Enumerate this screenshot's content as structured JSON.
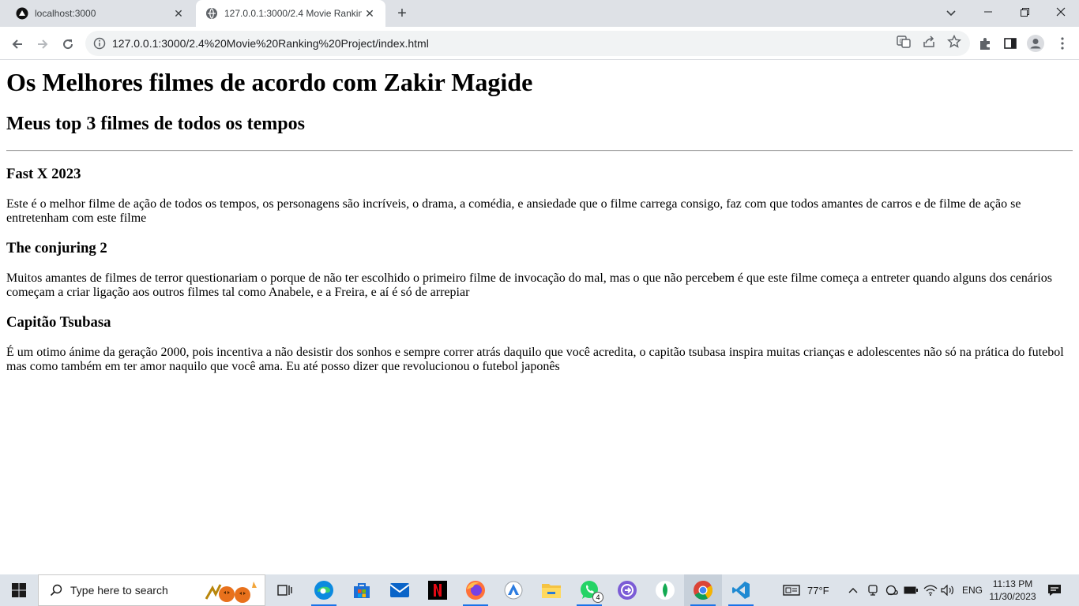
{
  "browser": {
    "tabs": [
      {
        "title": "localhost:3000",
        "active": false
      },
      {
        "title": "127.0.0.1:3000/2.4 Movie Rankin",
        "active": true
      }
    ],
    "new_tab_label": "+",
    "url": "127.0.0.1:3000/2.4%20Movie%20Ranking%20Project/index.html"
  },
  "page": {
    "h1": "Os Melhores filmes de acordo com Zakir Magide",
    "h2": "Meus top 3 filmes de todos os tempos",
    "movies": [
      {
        "title": "Fast X 2023",
        "description": "Este é o melhor filme de ação de todos os tempos, os personagens são incríveis, o drama, a comédia, e ansiedade que o filme carrega consigo, faz com que todos amantes de carros e de filme de ação se entretenham com este filme"
      },
      {
        "title": "The conjuring 2",
        "description": "Muitos amantes de filmes de terror questionariam o porque de não ter escolhido o primeiro filme de invocação do mal, mas o que não percebem é que este filme começa a entreter quando alguns dos cenários começam a criar ligação aos outros filmes tal como Anabele, e a Freira, e aí é só de arrepiar"
      },
      {
        "title": "Capitão Tsubasa",
        "description": "É um otimo ánime da geração 2000, pois incentiva a não desistir dos sonhos e sempre correr atrás daquilo que você acredita, o capitão tsubasa inspira muitas crianças e adolescentes não só na prática do futebol mas como também em ter amor naquilo que você ama. Eu até posso dizer que revolucionou o futebol japonês"
      }
    ]
  },
  "taskbar": {
    "search_placeholder": "Type here to search",
    "weather": "77°F",
    "language": "ENG",
    "time": "11:13 PM",
    "date": "11/30/2023",
    "whatsapp_badge": "4"
  },
  "colors": {
    "tabstrip": "#dee1e6",
    "omnibox": "#f1f3f4",
    "taskbar": "#dde3ea",
    "accent": "#1a73e8"
  }
}
